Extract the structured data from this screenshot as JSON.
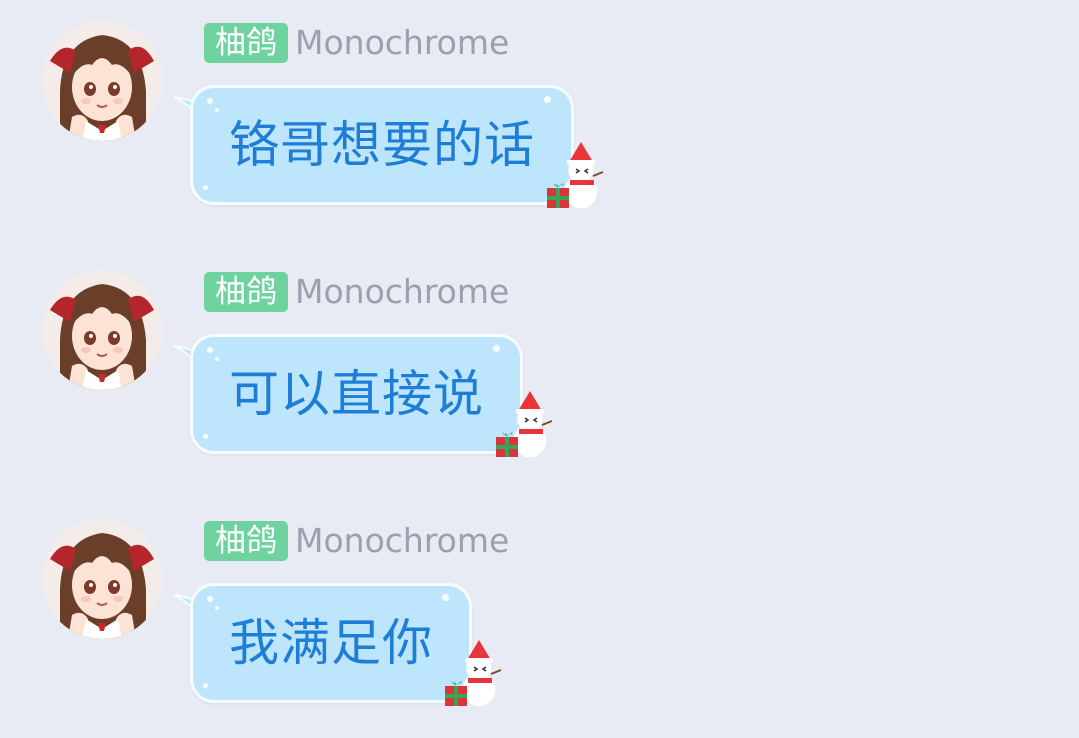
{
  "messages": [
    {
      "sender_tag": "柚鸽",
      "sender_name": "Monochrome",
      "text": "铬哥想要的话"
    },
    {
      "sender_tag": "柚鸽",
      "sender_name": "Monochrome",
      "text": "可以直接说"
    },
    {
      "sender_tag": "柚鸽",
      "sender_name": "Monochrome",
      "text": "我满足你"
    }
  ],
  "colors": {
    "background": "#e9ebf4",
    "tag_bg": "#6fd3a0",
    "bubble_bg": "#bde6fc",
    "bubble_text": "#1e7dd6",
    "name_text": "#9aa0ae"
  },
  "icons": {
    "avatar": "anime-girl-avatar",
    "bubble_decoration": "snowman-with-gift-icon"
  }
}
